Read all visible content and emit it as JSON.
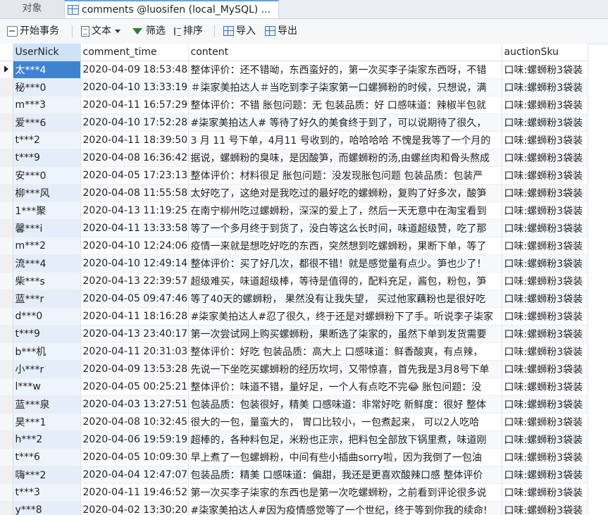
{
  "tabs": {
    "objects": "对象",
    "active": "comments @luosifen (local_MySQL) ..."
  },
  "toolbar": {
    "begin_transaction": "开始事务",
    "text": "文本",
    "filter": "筛选",
    "sort": "排序",
    "import": "导入",
    "export": "导出"
  },
  "columns": [
    "UserNick",
    "comment_time",
    "content",
    "auctionSku"
  ],
  "rows": [
    {
      "nick": "太***4",
      "time": "2020-04-09 18:53:48",
      "content": "整体评价：还不错呦，东西蛮好的，第一次买李子柒家东西呀，不错",
      "sku": "口味:螺蛳粉3袋装"
    },
    {
      "nick": "秘***0",
      "time": "2020-04-10 13:33:19",
      "content": "＃柒家美拍达人＃当吃到李子柒家第一口螺狮粉的时候，只想说，满",
      "sku": "口味:螺蛳粉3袋装"
    },
    {
      "nick": "m***3",
      "time": "2020-04-11 16:57:29",
      "content": "整体评价：不错 胀包问题：无 包装品质：好 口感味道：辣椒半包就",
      "sku": "口味:螺蛳粉3袋装"
    },
    {
      "nick": "爱***6",
      "time": "2020-04-10 17:52:28",
      "content": "#柒家美拍达人# 等待了好久的美食终于到了，可以说期待了很久，",
      "sku": "口味:螺蛳粉3袋装"
    },
    {
      "nick": "t***2",
      "time": "2020-04-11 18:39:50",
      "content": "3 月 11 号下单，4月11 号收到的，哈哈哈哈 不愧是我等了一个月的",
      "sku": "口味:螺蛳粉3袋装"
    },
    {
      "nick": "t***9",
      "time": "2020-04-08 16:36:42",
      "content": "据说，螺蛳粉的臭味，是因酸笋，而螺蛳粉的汤,由螺丝肉和骨头熬成",
      "sku": "口味:螺蛳粉3袋装"
    },
    {
      "nick": "安***0",
      "time": "2020-04-05 17:23:13",
      "content": "整体评价：材料很足 胀包问题：没发现胀包问题 包装品质：包装严",
      "sku": "口味:螺蛳粉3袋装"
    },
    {
      "nick": "柳***风",
      "time": "2020-04-08 11:55:58",
      "content": "太好吃了，这绝对是我吃过的最好吃的螺蛳粉，复购了好多次，酸笋",
      "sku": "口味:螺蛳粉3袋装"
    },
    {
      "nick": "1***聚",
      "time": "2020-04-13 11:19:25",
      "content": "在南宁柳州吃过螺蛳粉，深深的爱上了，然后一天无意中在淘宝看到",
      "sku": "口味:螺蛳粉3袋装"
    },
    {
      "nick": "馨***i",
      "time": "2020-04-11 13:33:58",
      "content": "等了一个多月终于到货了，没白等这么长时间，味道超级赞，吃了那",
      "sku": "口味:螺蛳粉3袋装"
    },
    {
      "nick": "m***2",
      "time": "2020-04-10 12:24:06",
      "content": "疫情一来就是想吃好吃的东西，突然想到吃螺蛳粉，果断下单，等了",
      "sku": "口味:螺蛳粉3袋装"
    },
    {
      "nick": "流***4",
      "time": "2020-04-10 12:49:14",
      "content": "整体评价：买了好几次，都很不错！就是感觉量有点少。笋也少了！",
      "sku": "口味:螺蛳粉3袋装"
    },
    {
      "nick": "柴***s",
      "time": "2020-04-13 22:39:57",
      "content": "超级难买，味道超级棒，等待是值得的，配料充足，酱包，粉包，笋",
      "sku": "口味:螺蛳粉3袋装"
    },
    {
      "nick": "蓝***r",
      "time": "2020-04-05 09:47:46",
      "content": "等了40天的螺蛳粉， 果然没有让我失望， 买过他家藕粉也是很好吃",
      "sku": "口味:螺蛳粉3袋装"
    },
    {
      "nick": "d***0",
      "time": "2020-04-11 18:16:28",
      "content": "#柒家美拍达人#忍了很久，终于还是对螺蛳粉下了手。听说李子柒家",
      "sku": "口味:螺蛳粉3袋装"
    },
    {
      "nick": "t***9",
      "time": "2020-04-13 23:40:17",
      "content": "第一次尝试网上购买螺蛳粉，果断选了柒家的，虽然下单到发货需要",
      "sku": "口味:螺蛳粉3袋装"
    },
    {
      "nick": "b***机",
      "time": "2020-04-11 20:31:03",
      "content": "整体评价：好吃 包装品质：高大上 口感味道：鲜香酸爽，有点辣，",
      "sku": "口味:螺蛳粉3袋装"
    },
    {
      "nick": "小***r",
      "time": "2020-04-09 13:53:28",
      "content": "先说一下坐吃买螺蛳粉的经历坎坷，又带惊喜，首先我是3月8号下单",
      "sku": "口味:螺蛳粉3袋装"
    },
    {
      "nick": "l***w",
      "time": "2020-04-05 00:25:21",
      "content": "整体评价：味道不错，量好足，一个人有点吃不完😂 胀包问题：没",
      "sku": "口味:螺蛳粉3袋装"
    },
    {
      "nick": "蓝***泉",
      "time": "2020-04-03 13:27:51",
      "content": "包装品质：包装很好，精美 口感味道：非常好吃 新鲜度：很好 整体",
      "sku": "口味:螺蛳粉3袋装"
    },
    {
      "nick": "昊***1",
      "time": "2020-04-08 10:32:45",
      "content": "很大的一包，量蛮大的， 胃口比较小，一包煮起来， 可以2人吃哈",
      "sku": "口味:螺蛳粉3袋装"
    },
    {
      "nick": "h***2",
      "time": "2020-04-06 19:59:19",
      "content": "超棒的，各种料包足，米粉也正宗，把料包全部放下锅里煮，味道刚",
      "sku": "口味:螺蛳粉3袋装"
    },
    {
      "nick": "t***6",
      "time": "2020-04-05 10:09:30",
      "content": "早上煮了一包螺蛳粉，中间有些小插曲sorry啦，因为我倒了一包油",
      "sku": "口味:螺蛳粉3袋装"
    },
    {
      "nick": "嗨***2",
      "time": "2020-04-04 12:47:07",
      "content": "包装品质：精美 口感味道：偏甜，我还是更喜欢酸辣口感 整体评价",
      "sku": "口味:螺蛳粉3袋装"
    },
    {
      "nick": "t***3",
      "time": "2020-04-11 19:46:52",
      "content": "第一次买李子柒家的东西也是第一次吃螺蛳粉，之前看到评论很多说",
      "sku": "口味:螺蛳粉3袋装"
    },
    {
      "nick": "y***8",
      "time": "2020-04-02 13:30:20",
      "content": "#柒家美拍达人#因为疫情感觉等了一个世纪，终于等到你我的续命!",
      "sku": "口味:螺蛳粉3袋装"
    }
  ]
}
